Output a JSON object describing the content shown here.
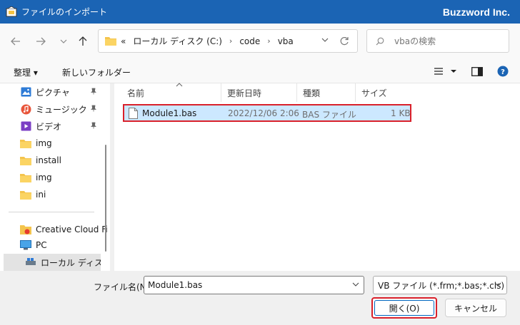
{
  "window": {
    "title": "ファイルのインポート",
    "brand": "Buzzword Inc."
  },
  "address": {
    "overflow": "«",
    "crumbs": [
      "ローカル ディスク (C:)",
      "code",
      "vba"
    ]
  },
  "search": {
    "placeholder": "vbaの検索"
  },
  "toolbar": {
    "organize": "整理 ▾",
    "new_folder": "新しいフォルダー"
  },
  "sidebar": {
    "quick": [
      {
        "label": "ピクチャ",
        "icon": "pictures-icon",
        "pinned": true
      },
      {
        "label": "ミュージック",
        "icon": "music-icon",
        "pinned": true
      },
      {
        "label": "ビデオ",
        "icon": "video-icon",
        "pinned": true
      },
      {
        "label": "img",
        "icon": "folder-icon",
        "pinned": false
      },
      {
        "label": "install",
        "icon": "folder-icon",
        "pinned": false
      },
      {
        "label": "img",
        "icon": "folder-icon",
        "pinned": false
      },
      {
        "label": "ini",
        "icon": "folder-icon",
        "pinned": false
      }
    ],
    "cloud": "Creative Cloud Fil",
    "pc": "PC",
    "drive": "ローカル ディスク (C"
  },
  "columns": {
    "name": "名前",
    "modified": "更新日時",
    "type": "種類",
    "size": "サイズ"
  },
  "files": [
    {
      "name": "Module1.bas",
      "modified": "2022/12/06 2:06",
      "type": "BAS ファイル",
      "size": "1 KB"
    }
  ],
  "bottom": {
    "filename_label": "ファイル名(N):",
    "filename_value": "Module1.bas",
    "filter": "VB ファイル (*.frm;*.bas;*.cls)",
    "open": "開く(O)",
    "cancel": "キャンセル"
  },
  "colors": {
    "titlebar": "#1b64b4",
    "selection": "#cce8ff",
    "highlight": "#d9202a",
    "accent": "#0067c0"
  }
}
